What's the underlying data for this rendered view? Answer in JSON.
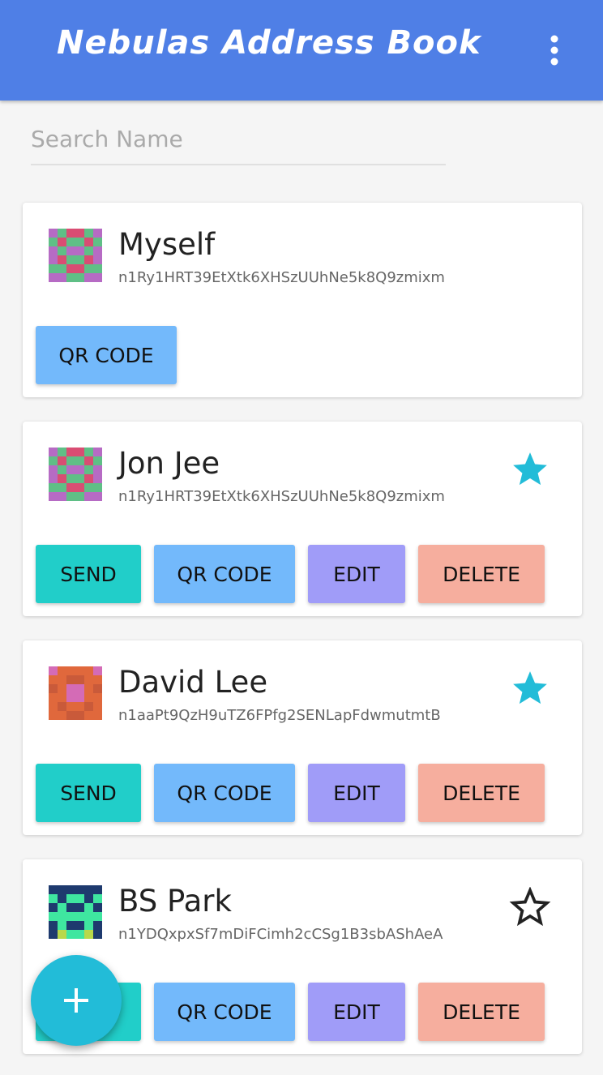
{
  "appbar": {
    "title": "Nebulas Address Book",
    "menu_icon": "more-vert-icon",
    "color": "#4f7fe6"
  },
  "search": {
    "placeholder": "Search Name",
    "value": ""
  },
  "contacts": [
    {
      "name": "Myself",
      "address": "n1Ry1HRT39EtXtk6XHSzUUhNe5k8Q9zmixm",
      "avatar_icon": "identicon-icon",
      "qr_label": "QR CODE"
    },
    {
      "name": "Jon Jee",
      "address": "n1Ry1HRT39EtXtk6XHSzUUhNe5k8Q9zmixm",
      "starred": true,
      "avatar_icon": "identicon-icon",
      "send_label": "SEND",
      "qr_label": "QR CODE",
      "edit_label": "EDIT",
      "delete_label": "DELETE"
    },
    {
      "name": "David Lee",
      "address": "n1aaPt9QzH9uTZ6FPfg2SENLapFdwmutmtB",
      "starred": true,
      "avatar_icon": "identicon-icon",
      "send_label": "SEND",
      "qr_label": "QR CODE",
      "edit_label": "EDIT",
      "delete_label": "DELETE"
    },
    {
      "name": "BS Park",
      "address": "n1YDQxpxSf7mDiFCimh2cCSg1B3sbAShAeA",
      "starred": false,
      "avatar_icon": "identicon-icon",
      "send_label": "SEND",
      "qr_label": "QR CODE",
      "edit_label": "EDIT",
      "delete_label": "DELETE"
    }
  ],
  "fab": {
    "icon": "plus-icon",
    "color": "#22bcd8"
  },
  "colors": {
    "send": "#21cec9",
    "qr": "#73b9fb",
    "edit": "#a09cf8",
    "delete": "#f6ae9e",
    "star": "#22bcd8"
  }
}
